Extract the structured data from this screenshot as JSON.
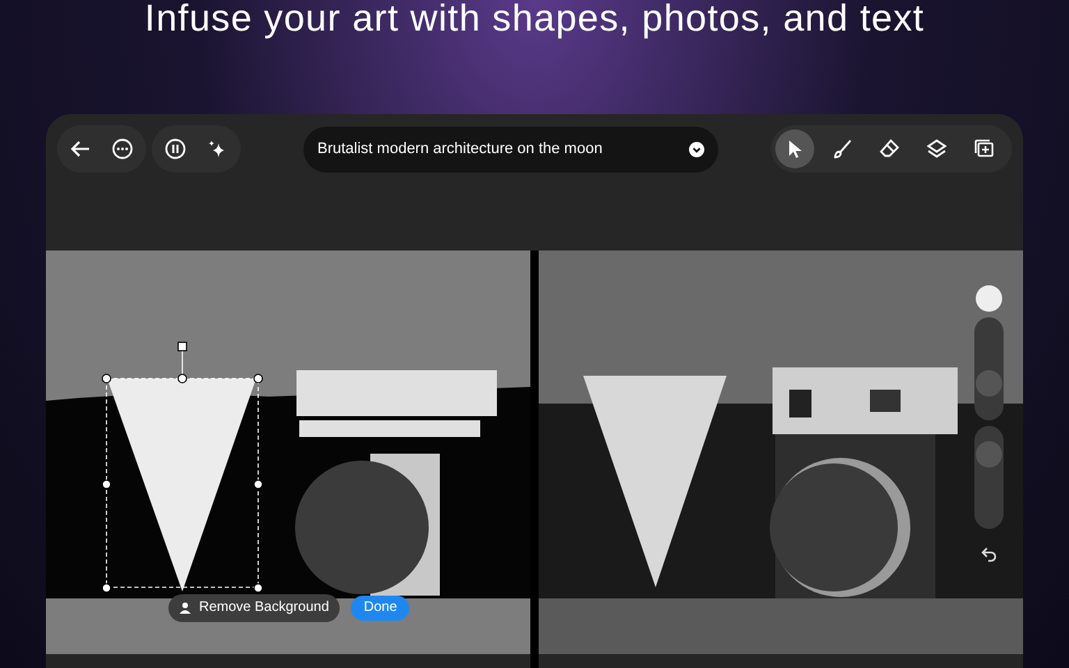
{
  "headline": "Infuse your art with shapes, photos, and text",
  "left_controls": [
    {
      "kind": "back"
    },
    {
      "kind": "more"
    }
  ],
  "left_controls_2": [
    {
      "kind": "pause"
    },
    {
      "kind": "sparkle"
    }
  ],
  "prompt": {
    "value": "Brutalist modern architecture on the moon"
  },
  "tools": [
    {
      "kind": "pointer",
      "selected": true
    },
    {
      "kind": "brush",
      "selected": false
    },
    {
      "kind": "eraser",
      "selected": false
    },
    {
      "kind": "layers",
      "selected": false
    },
    {
      "kind": "add-image",
      "selected": false
    }
  ],
  "selection_actions": {
    "remove_background": "Remove Background",
    "done": "Done"
  },
  "sliders": [
    {
      "level": 0.3
    },
    {
      "level": 0.8
    }
  ]
}
